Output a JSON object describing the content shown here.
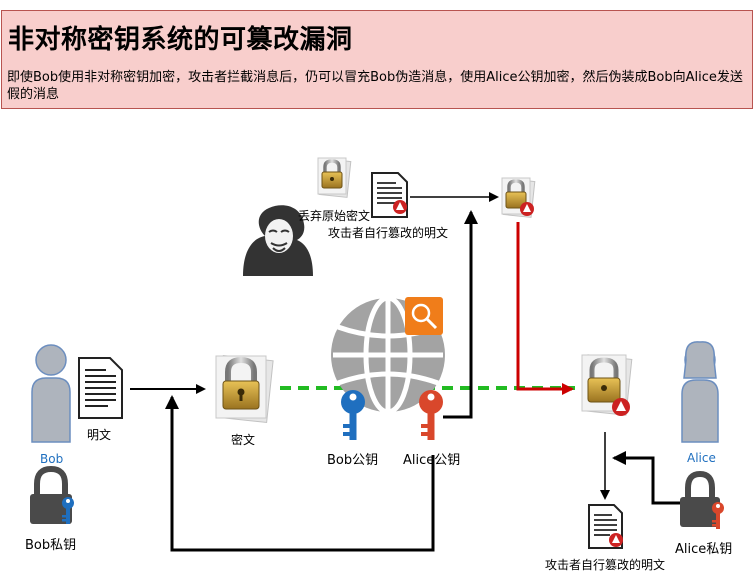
{
  "header": {
    "title": "非对称密钥系统的可篡改漏洞",
    "description": "即使Bob使用非对称密钥加密，攻击者拦截消息后，仍可以冒充Bob伪造消息，使用Alice公钥加密，然后伪装成Bob向Alice发送假的消息"
  },
  "labels": {
    "discard": "丢弃原始密文",
    "tampered_top": "攻击者自行篡改的明文",
    "plaintext": "明文",
    "bob": "Bob",
    "ciphertext": "密文",
    "bob_public_key": "Bob公钥",
    "alice_public_key": "Alice公钥",
    "alice": "Alice",
    "bob_private_key": "Bob私钥",
    "alice_private_key": "Alice私钥",
    "tampered_bottom": "攻击者自行篡改的明文"
  },
  "colors": {
    "banner_bg": "#f8cecc",
    "banner_border": "#b85450",
    "green_dash": "#22bb22",
    "red_arrow": "#cc0000",
    "blue_key": "#1f6fbf",
    "red_key": "#d9472b",
    "person_fill": "#aeb4bd",
    "person_stroke": "#6c8ebf",
    "globe": "#a0a0a0",
    "search_badge": "#f07d1a"
  },
  "icons": [
    "hacker-icon",
    "globe-icon",
    "search-icon",
    "lock-icon",
    "document-icon",
    "warning-icon",
    "key-icon",
    "person-icon"
  ]
}
